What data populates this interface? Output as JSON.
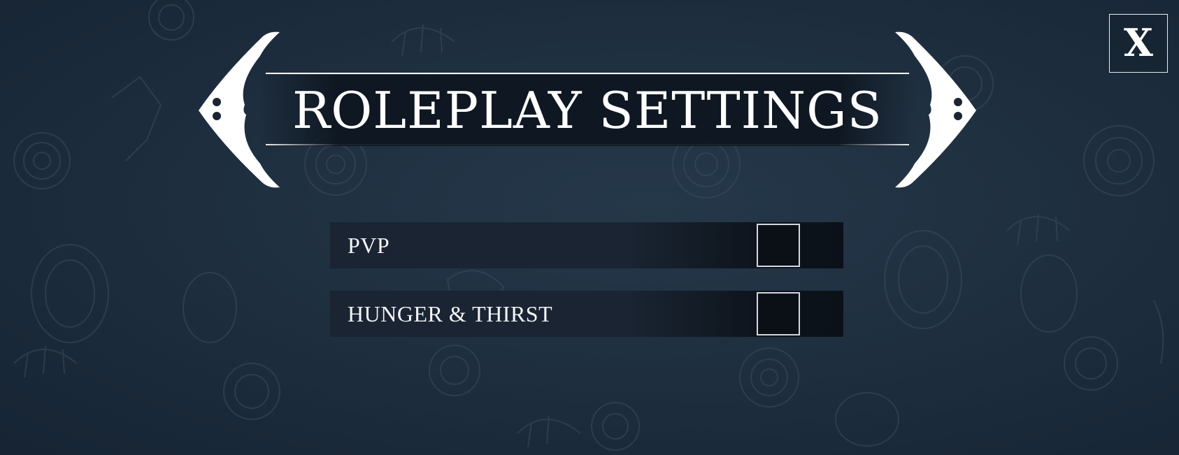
{
  "screen": {
    "title": "ROLEPLAY SETTINGS",
    "close_label": "X"
  },
  "settings": [
    {
      "label": "PVP",
      "checked": false
    },
    {
      "label": "HUNGER & THIRST",
      "checked": false
    }
  ],
  "colors": {
    "background": "#1f2f3f",
    "row_background": "#1a2432",
    "text": "#ffffff",
    "checkbox_border": "#d4d8de"
  },
  "icons": {
    "left_ornament": "left-arrow-ornament-icon",
    "right_ornament": "right-arrow-ornament-icon",
    "close": "close-icon"
  }
}
